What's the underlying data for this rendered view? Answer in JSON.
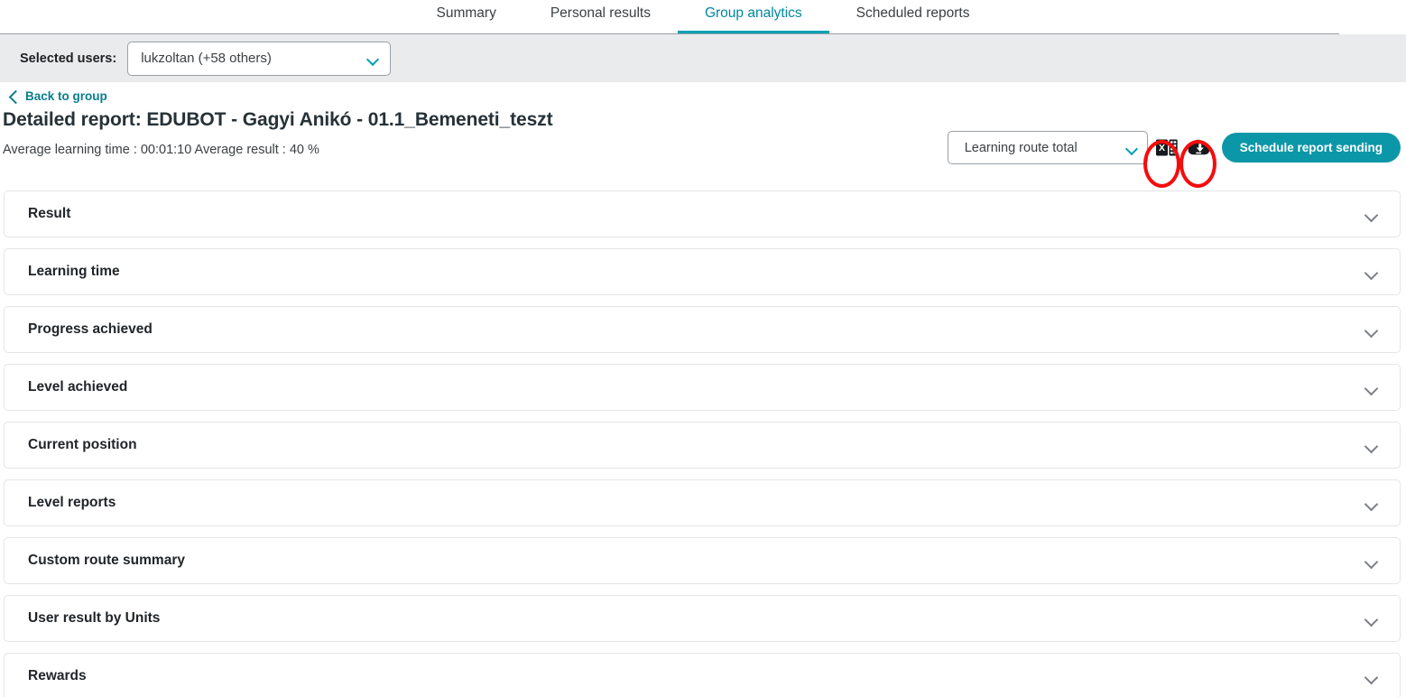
{
  "tabs": [
    {
      "label": "Summary",
      "active": false
    },
    {
      "label": "Personal results",
      "active": false
    },
    {
      "label": "Group analytics",
      "active": true
    },
    {
      "label": "Scheduled reports",
      "active": false
    }
  ],
  "user_band": {
    "label": "Selected users:",
    "selected_value": "lukzoltan (+58 others)",
    "chevron_icon": "chevron-down-icon"
  },
  "back_link": {
    "label": "Back to group",
    "icon": "chevron-left-icon"
  },
  "page_title": "Detailed report: EDUBOT - Gagyi Anikó - 01.1_Bemeneti_teszt",
  "stats": {
    "text": "Average learning time : 00:01:10  Average result : 40 %",
    "average_learning_time_label": "Average learning time :",
    "average_learning_time": "00:01:10",
    "average_result_label": "Average result :",
    "average_result": "40 %"
  },
  "controls": {
    "route_select": {
      "selected_value": "Learning route total",
      "chevron_icon": "chevron-down-icon"
    },
    "export_excel_icon": "excel-export-icon",
    "download_cloud_icon": "cloud-download-icon",
    "schedule_button_label": "Schedule report sending"
  },
  "annotations": [
    {
      "shape": "ellipse",
      "color": "#f40d0d",
      "target": "excel-export-icon"
    },
    {
      "shape": "ellipse",
      "color": "#f40d0d",
      "target": "cloud-download-icon"
    }
  ],
  "accordion": {
    "rows": [
      {
        "label": "Result",
        "chevron": "chevron-down-icon"
      },
      {
        "label": "Learning time",
        "chevron": "chevron-down-icon"
      },
      {
        "label": "Progress achieved",
        "chevron": "chevron-down-icon"
      },
      {
        "label": "Level achieved",
        "chevron": "chevron-down-icon"
      },
      {
        "label": "Current position",
        "chevron": "chevron-down-icon"
      },
      {
        "label": "Level reports",
        "chevron": "chevron-down-icon"
      },
      {
        "label": "Custom route summary",
        "chevron": "chevron-down-icon"
      },
      {
        "label": "User result by Units",
        "chevron": "chevron-down-icon"
      },
      {
        "label": "Rewards",
        "chevron": "chevron-down-icon"
      }
    ]
  },
  "colors": {
    "accent_teal": "#00a0b4",
    "button_teal": "#0c97a8",
    "annotation_red": "#f40d0d",
    "band_gray": "#eaebec"
  }
}
